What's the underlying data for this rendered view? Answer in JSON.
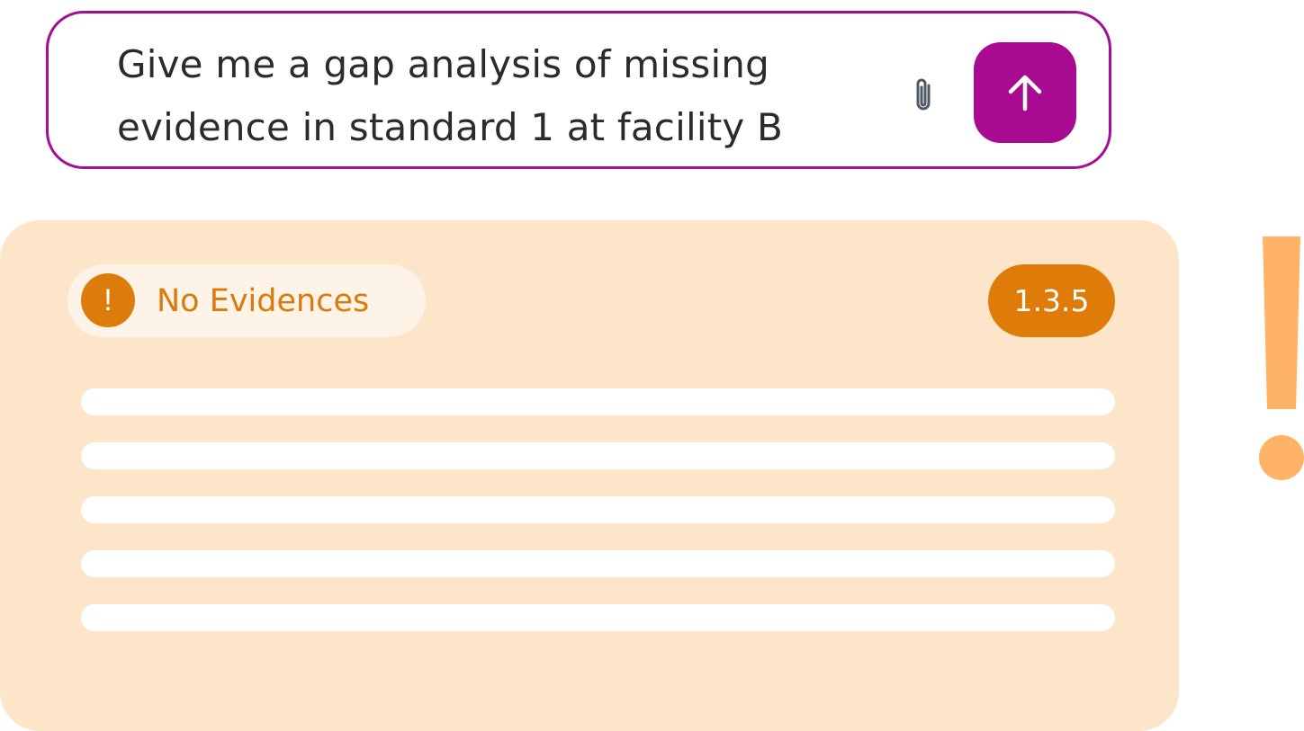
{
  "prompt": {
    "text": "Give me a gap analysis of missing evidence in standard 1 at facility B",
    "attach_icon": "paperclip-icon",
    "send_icon": "arrow-up-icon"
  },
  "result_card": {
    "status": {
      "icon_glyph": "!",
      "label": "No Evidences"
    },
    "code": "1.3.5",
    "placeholder_line_count": 5
  },
  "colors": {
    "accent_purple": "#a80a92",
    "warning_orange": "#de7c0b",
    "card_background": "#fde5ca",
    "alert_mark": "#ffb366"
  },
  "decorations": {
    "alert_icon": "exclamation-mark-icon"
  }
}
